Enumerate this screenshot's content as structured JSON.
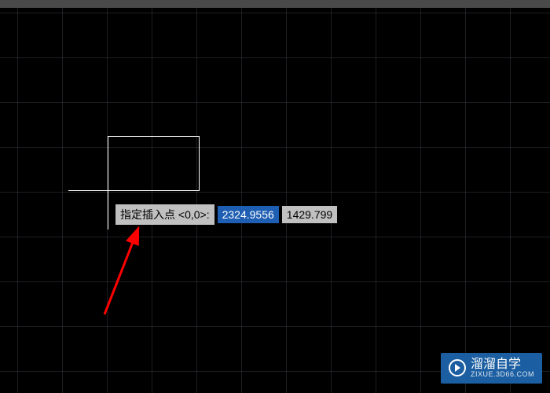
{
  "prompt": {
    "label": "指定插入点 <0,0>:",
    "x_value": "2324.9556",
    "y_value": "1429.799"
  },
  "watermark": {
    "title": "溜溜自学",
    "subtitle": "ZIXUE.3D66.COM"
  },
  "grid": {
    "spacing": 57,
    "color": "#3c3c46"
  },
  "colors": {
    "background": "#000000",
    "object_stroke": "#ffffff",
    "selection": "#1e5eb3",
    "arrow": "#ff0000",
    "watermark_bg": "#1b5ea1"
  }
}
